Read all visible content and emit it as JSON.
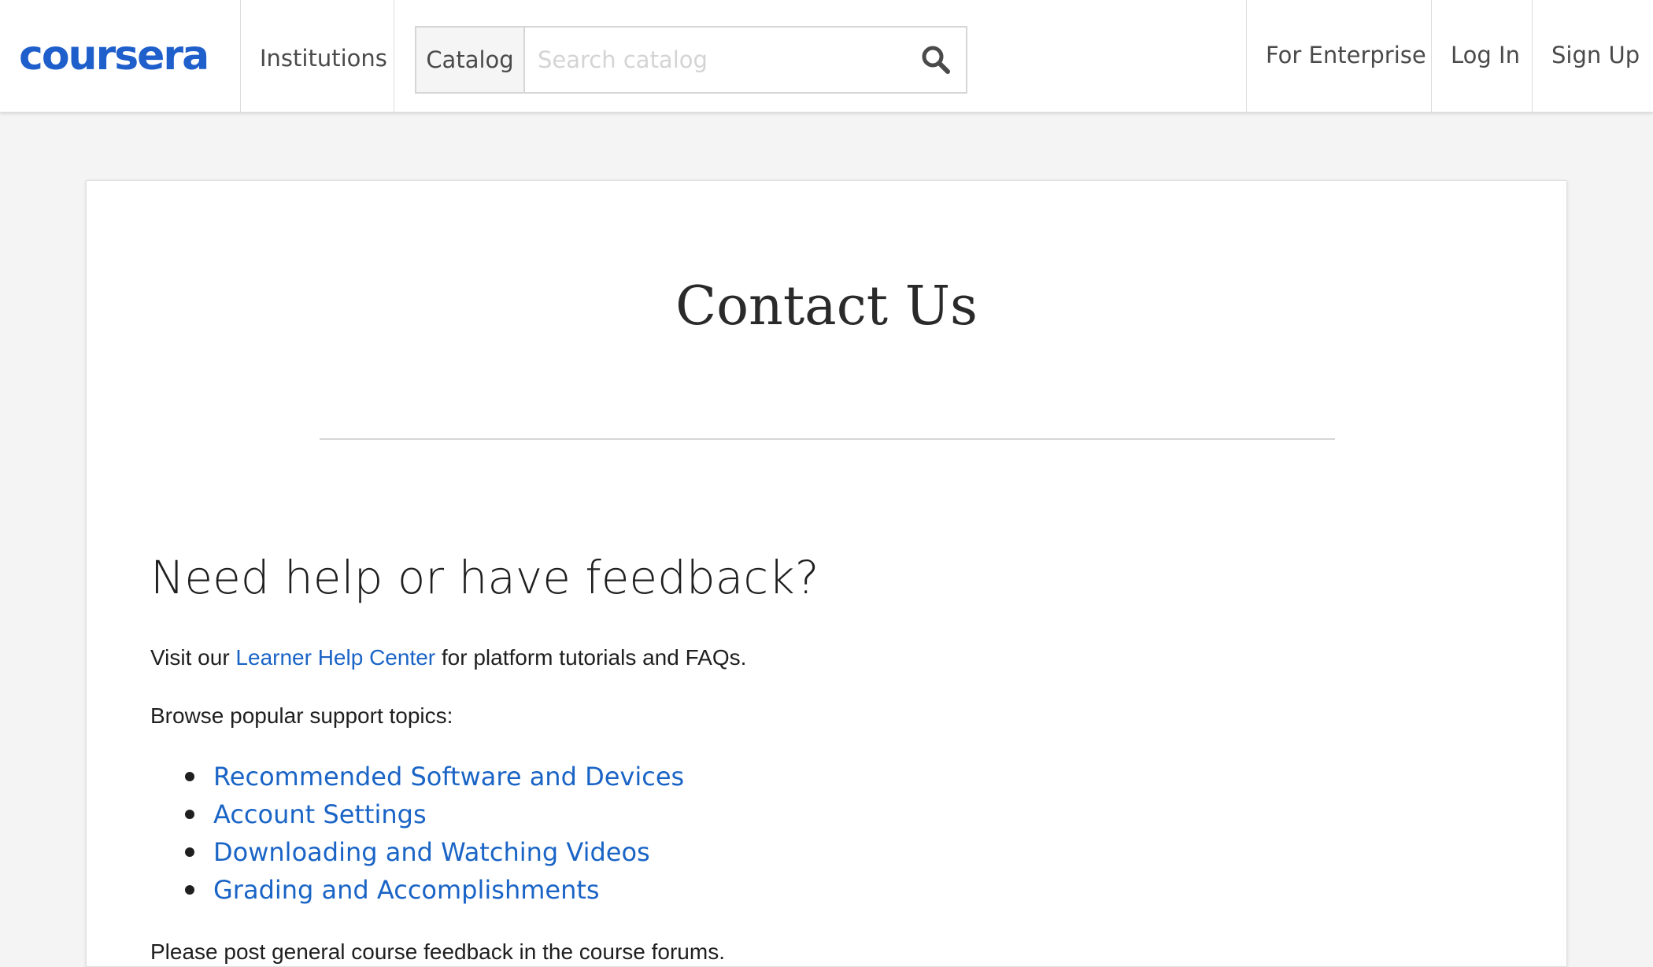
{
  "header": {
    "logo_text": "coursera",
    "institutions_label": "Institutions",
    "catalog_label": "Catalog",
    "search": {
      "placeholder": "Search catalog",
      "value": "",
      "icon": "search-icon"
    },
    "enterprise_label": "For Enterprise",
    "login_label": "Log In",
    "signup_label": "Sign Up"
  },
  "main": {
    "title": "Contact Us",
    "help_heading": "Need help or have feedback?",
    "visit_prefix": "Visit our ",
    "help_center_link": "Learner Help Center",
    "visit_suffix": " for platform tutorials and FAQs.",
    "browse_text": "Browse popular support topics:",
    "topics": [
      "Recommended Software and Devices",
      "Account Settings",
      "Downloading and Watching Videos",
      "Grading and Accomplishments"
    ],
    "forum_text": "Please post general course feedback in the course forums."
  },
  "colors": {
    "brand": "#1f5fcc",
    "link": "#1a64c6",
    "page_background": "#f4f4f4"
  }
}
